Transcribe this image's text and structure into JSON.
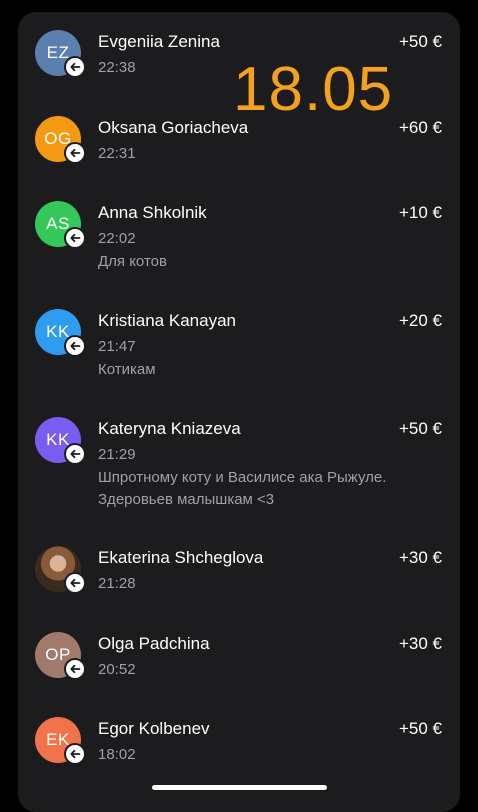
{
  "overlay_date": "18.05",
  "currency": "€",
  "colors": {
    "background": "#000000",
    "card": "#1c1c1e",
    "overlay": "#f4a21b",
    "secondary_text": "#a1a1a6"
  },
  "transactions": [
    {
      "initials": "EZ",
      "avatar_color": "#5b7fae",
      "name": "Evgeniia Zenina",
      "time": "22:38",
      "comment": "",
      "amount": "+50 €",
      "icon": "incoming-arrow-icon"
    },
    {
      "initials": "OG",
      "avatar_color": "#f39a12",
      "name": "Oksana Goriacheva",
      "time": "22:31",
      "comment": "",
      "amount": "+60 €",
      "icon": "incoming-arrow-icon"
    },
    {
      "initials": "AS",
      "avatar_color": "#34c759",
      "name": "Anna Shkolnik",
      "time": "22:02",
      "comment": "Для котов",
      "amount": "+10 €",
      "icon": "incoming-arrow-icon"
    },
    {
      "initials": "KK",
      "avatar_color": "#2f9cf0",
      "name": "Kristiana Kanayan",
      "time": "21:47",
      "comment": "Котикам",
      "amount": "+20 €",
      "icon": "incoming-arrow-icon"
    },
    {
      "initials": "KK",
      "avatar_color": "#7b5cf0",
      "name": "Kateryna Kniazeva",
      "time": "21:29",
      "comment": "Шпротному коту и Василисе ака Рыжуле. Здеровьев малышкам <3",
      "amount": "+50 €",
      "icon": "incoming-arrow-icon"
    },
    {
      "initials": "",
      "avatar_color": "#8a5a3a",
      "name": "Ekaterina Shcheglova",
      "time": "21:28",
      "comment": "",
      "amount": "+30 €",
      "icon": "incoming-arrow-icon"
    },
    {
      "initials": "OP",
      "avatar_color": "#a07a6a",
      "name": "Olga Padchina",
      "time": "20:52",
      "comment": "",
      "amount": "+30 €",
      "icon": "incoming-arrow-icon"
    },
    {
      "initials": "EK",
      "avatar_color": "#f2734a",
      "name": "Egor Kolbenev",
      "time": "18:02",
      "comment": "",
      "amount": "+50 €",
      "icon": "incoming-arrow-icon"
    }
  ]
}
